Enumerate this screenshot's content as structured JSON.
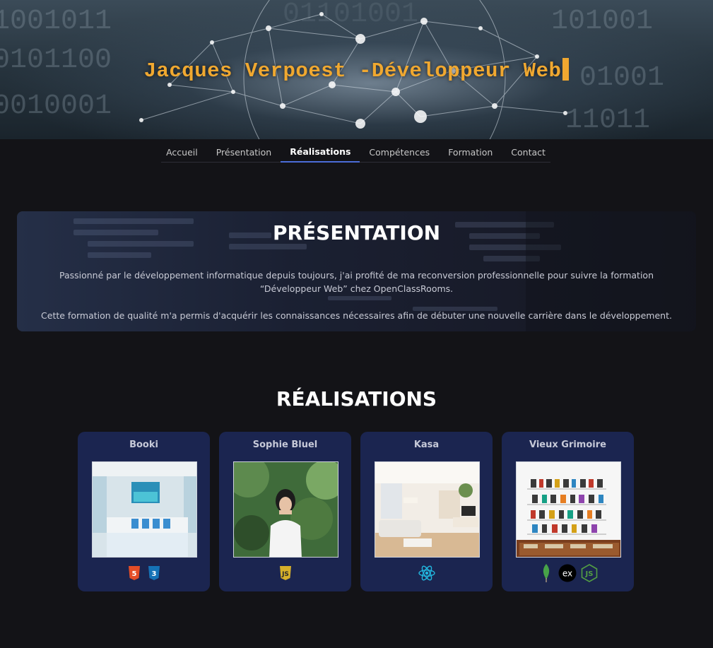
{
  "hero": {
    "title": "Jacques Verpoest -Développeur Web"
  },
  "nav": {
    "items": [
      {
        "label": "Accueil"
      },
      {
        "label": "Présentation"
      },
      {
        "label": "Réalisations",
        "active": true
      },
      {
        "label": "Compétences"
      },
      {
        "label": "Formation"
      },
      {
        "label": "Contact"
      }
    ],
    "active_underline_color": "#4b6cd8"
  },
  "presentation": {
    "title": "PRÉSENTATION",
    "paragraph1": "Passionné par le développement informatique depuis toujours, j'ai profité de ma reconversion professionnelle pour suivre la formation “Développeur Web” chez OpenClassRooms.",
    "paragraph2": "Cette formation de qualité m'a permis d'acquérir les connaissances nécessaires afin de débuter une nouvelle carrière dans le développement."
  },
  "realisations": {
    "title": "RÉALISATIONS",
    "projects": [
      {
        "name": "Booki",
        "image": "bedroom-photo",
        "icons": [
          "html5-icon",
          "css3-icon"
        ]
      },
      {
        "name": "Sophie Bluel",
        "image": "portrait-photo",
        "icons": [
          "javascript-icon"
        ]
      },
      {
        "name": "Kasa",
        "image": "living-room-photo",
        "icons": [
          "react-icon"
        ]
      },
      {
        "name": "Vieux Grimoire",
        "image": "bookshelf-photo",
        "icons": [
          "mongodb-icon",
          "express-icon",
          "nodejs-icon"
        ]
      }
    ]
  },
  "colors": {
    "background": "#131317",
    "accent_title": "#f0a830",
    "card_bg": "#1b2550"
  }
}
